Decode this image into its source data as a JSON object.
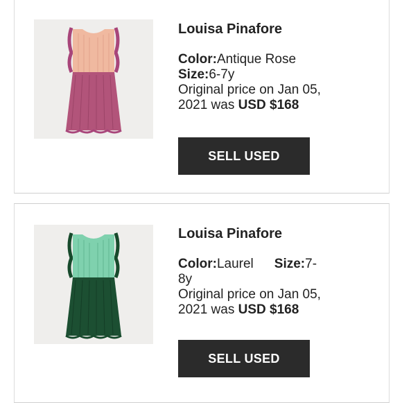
{
  "items": [
    {
      "product_name": "Louisa Pinafore",
      "color_label": "Color:",
      "color_value": "Antique Rose",
      "size_label": "Size:",
      "size_value": "6-7y",
      "price_text_1": "Original price on Jan 05,",
      "price_text_2": "2021 was ",
      "price_value": "USD $168",
      "button_label": "SELL USED",
      "image_colors": {
        "bodice": "#f0b9a0",
        "skirt": "#b2547a",
        "ruffle": "#a8457a"
      }
    },
    {
      "product_name": "Louisa Pinafore",
      "color_label": "Color:",
      "color_value": "Laurel",
      "size_label": "Size:",
      "size_value": "7-",
      "size_value_wrap": "8y",
      "price_text_1": "Original price on Jan 05,",
      "price_text_2": "2021 was ",
      "price_value": "USD $168",
      "button_label": "SELL USED",
      "image_colors": {
        "bodice": "#7fd1ae",
        "skirt": "#1c4f32",
        "ruffle": "#174a2c"
      }
    }
  ]
}
